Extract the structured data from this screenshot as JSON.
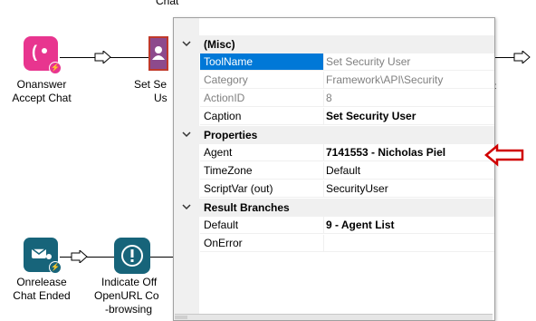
{
  "canvas": {
    "top_partial_label": "Chat",
    "nodes": [
      {
        "label_line1": "Onanswer",
        "label_line2": "Accept Chat",
        "icon": "chat-phone-icon",
        "color": "#e8358f"
      },
      {
        "label_line1": "Set Se",
        "label_line2": "Us",
        "icon": "user-icon",
        "color": "#8d4a8c"
      },
      {
        "label_line1": "Onrelease",
        "label_line2": "Chat Ended",
        "icon": "chat-end-icon",
        "color": "#17647a"
      },
      {
        "label_line1": "Indicate Off",
        "label_line2": "OpenURL Co",
        "label_line3": "-browsing",
        "icon": "alert-icon",
        "color": "#17647a"
      }
    ]
  },
  "property_grid": {
    "categories": [
      {
        "title": "(Misc)",
        "rows": [
          {
            "name": "ToolName",
            "value": "Set Security User",
            "readonly": true,
            "selected": true
          },
          {
            "name": "Category",
            "value": "Framework\\API\\Security",
            "readonly": true
          },
          {
            "name": "ActionID",
            "value": "8",
            "readonly": true
          },
          {
            "name": "Caption",
            "value": "Set Security User",
            "bold": true
          }
        ]
      },
      {
        "title": "Properties",
        "rows": [
          {
            "name": "Agent",
            "value": "7141553 - Nicholas Piel",
            "bold": true
          },
          {
            "name": "TimeZone",
            "value": "Default"
          },
          {
            "name": "ScriptVar (out)",
            "value": "SecurityUser"
          }
        ]
      },
      {
        "title": "Result Branches",
        "rows": [
          {
            "name": "Default",
            "value": "9 - Agent List",
            "bold": true
          },
          {
            "name": "OnError",
            "value": ""
          }
        ]
      }
    ]
  },
  "annotation": {
    "icon": "red-arrow-left-icon",
    "color": "#d00000"
  }
}
